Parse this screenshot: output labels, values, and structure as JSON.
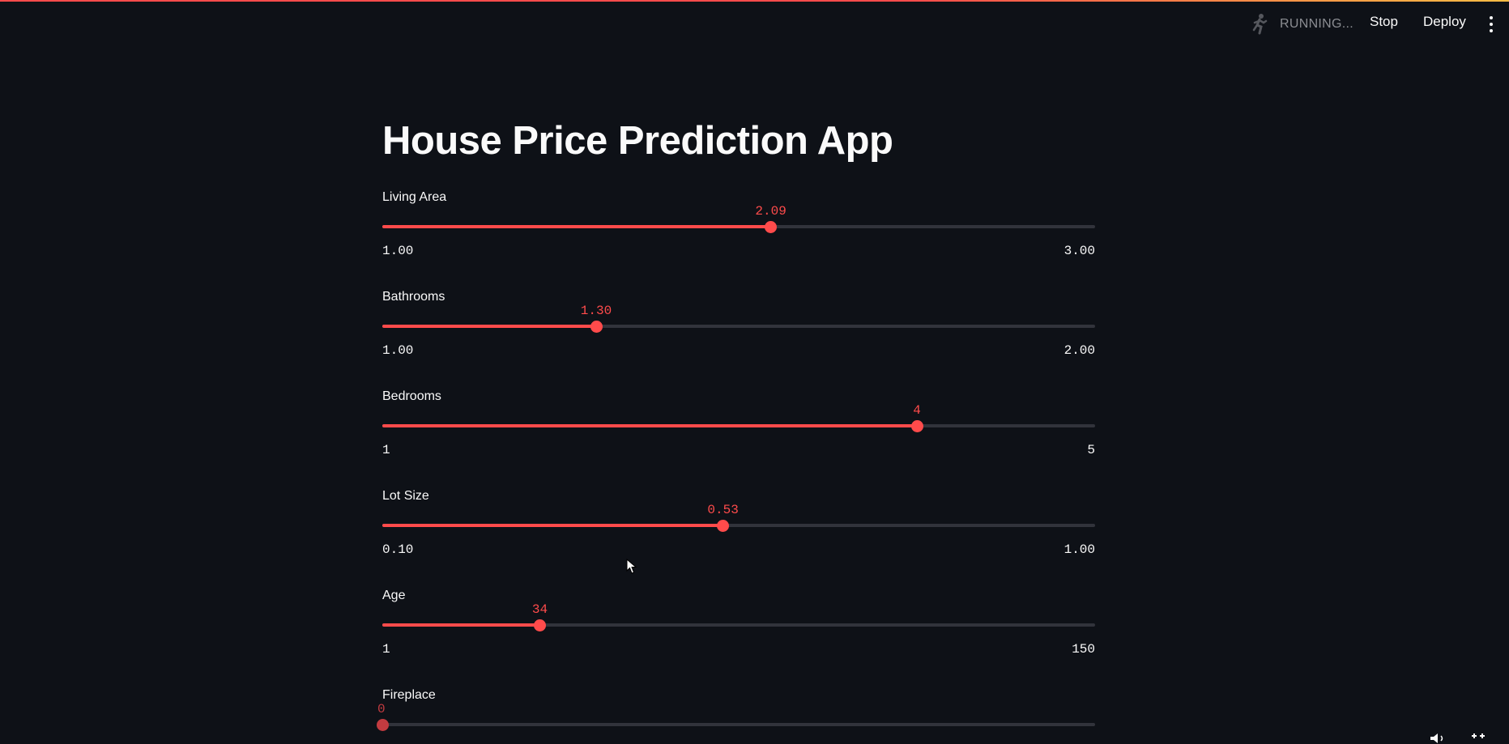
{
  "header": {
    "status_text": "RUNNING...",
    "stop_label": "Stop",
    "deploy_label": "Deploy",
    "status_icon": "running-man-icon",
    "menu_icon": "kebab-menu-icon"
  },
  "colors": {
    "background": "#0e1117",
    "accent": "#ff4b4b",
    "track": "#31333b",
    "text": "#fafafa",
    "muted": "#8b8d92"
  },
  "main": {
    "title": "House Price Prediction App",
    "sliders": [
      {
        "label": "Living Area",
        "value": "2.09",
        "min": "1.00",
        "max": "3.00",
        "fraction": 0.545
      },
      {
        "label": "Bathrooms",
        "value": "1.30",
        "min": "1.00",
        "max": "2.00",
        "fraction": 0.3
      },
      {
        "label": "Bedrooms",
        "value": "4",
        "min": "1",
        "max": "5",
        "fraction": 0.75
      },
      {
        "label": "Lot Size",
        "value": "0.53",
        "min": "0.10",
        "max": "1.00",
        "fraction": 0.478
      },
      {
        "label": "Age",
        "value": "34",
        "min": "1",
        "max": "150",
        "fraction": 0.221
      },
      {
        "label": "Fireplace",
        "value": "0",
        "min": "",
        "max": "",
        "fraction": 0.0
      }
    ]
  }
}
